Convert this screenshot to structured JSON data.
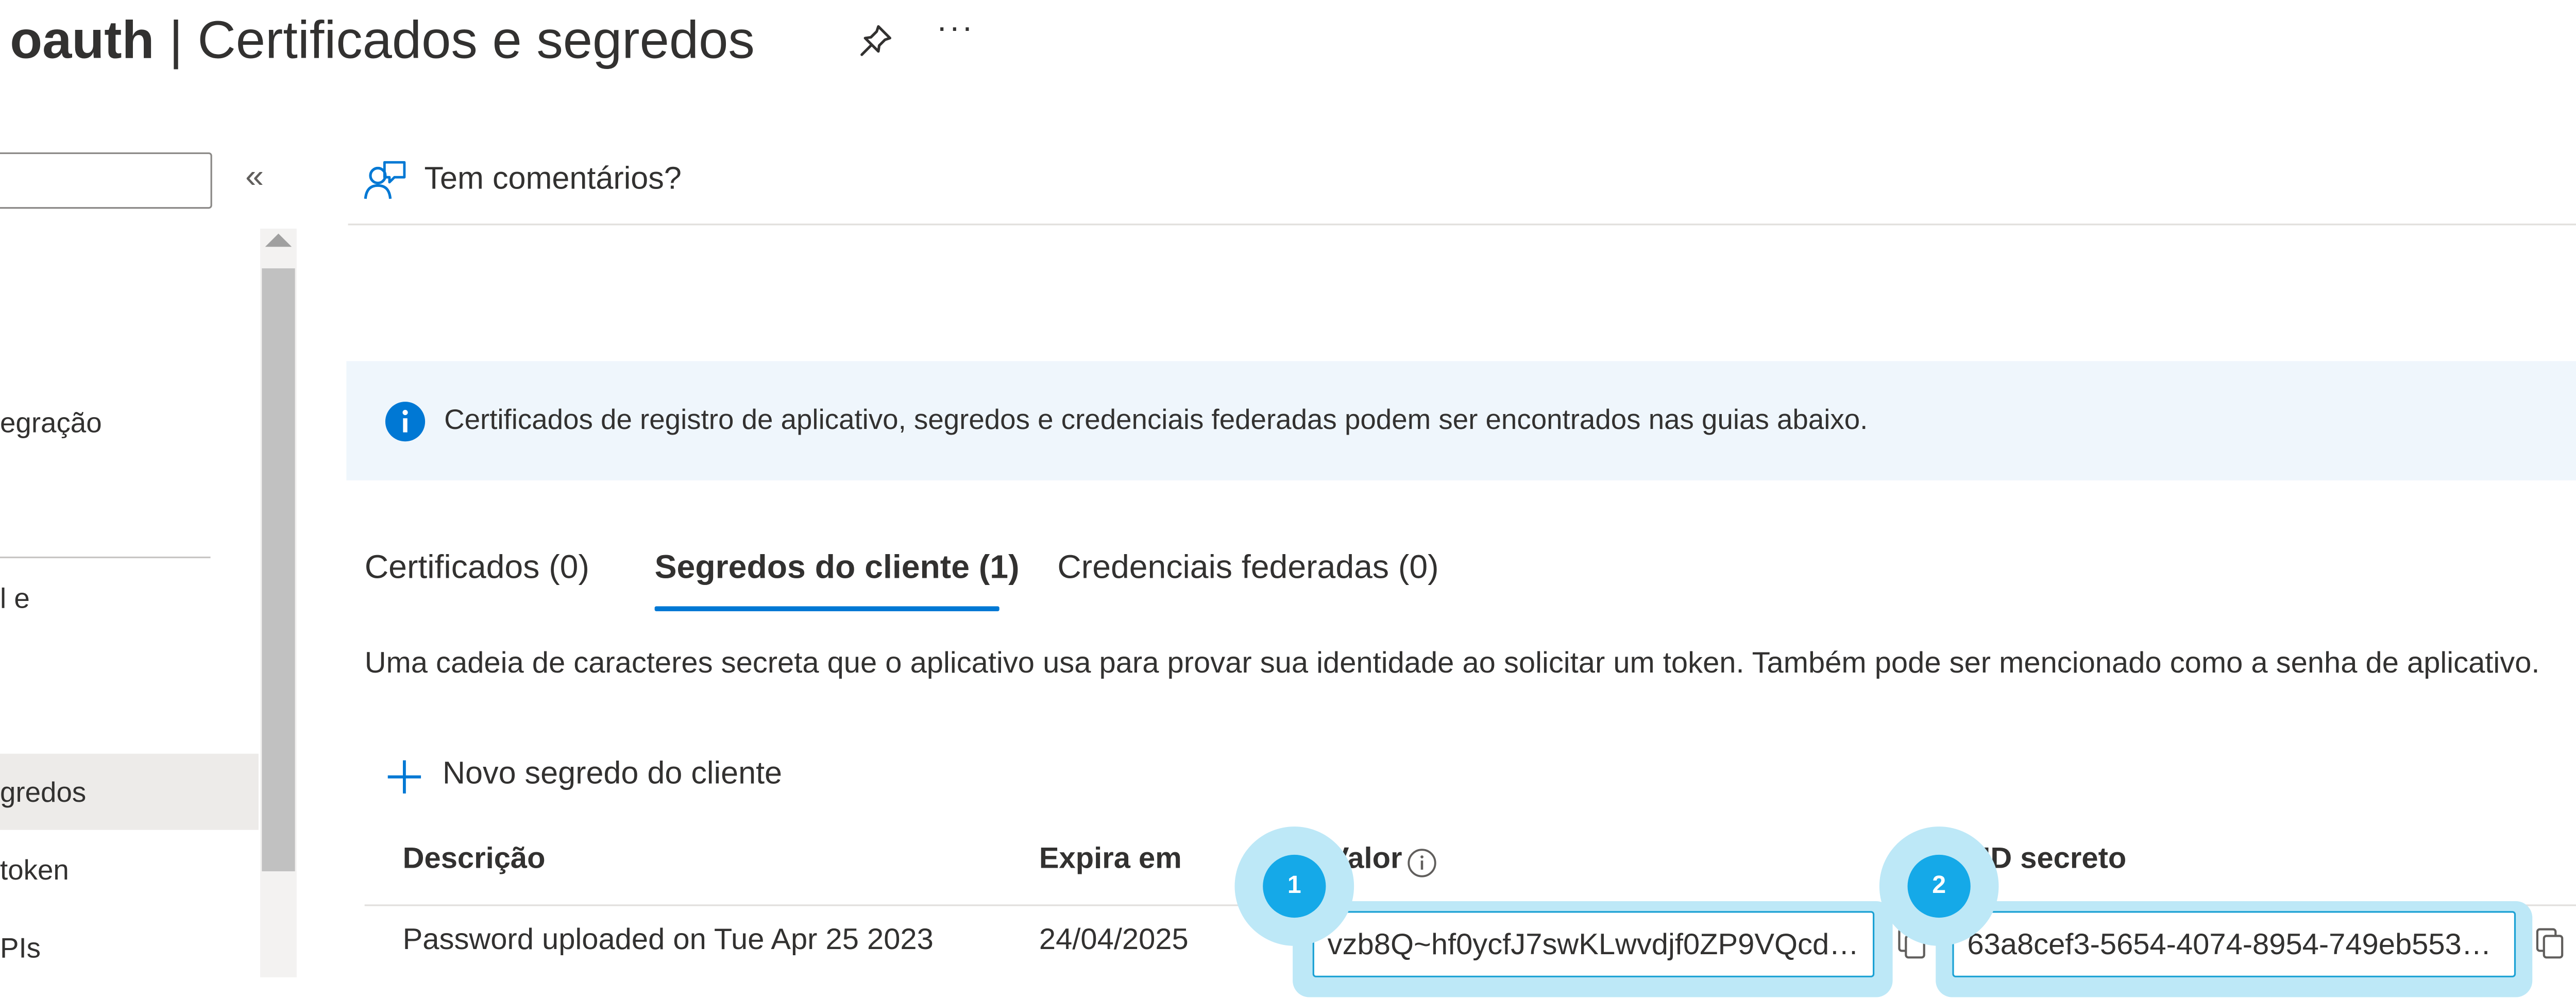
{
  "header": {
    "app_name": "oauth",
    "separator": " | ",
    "page_title": "Certificados e segredos",
    "more_label": "···"
  },
  "sidebar": {
    "collapse_label": "«",
    "items": [
      {
        "label": "egração"
      },
      {
        "label": "l e"
      },
      {
        "label": "gredos",
        "selected": true
      },
      {
        "label": " token"
      },
      {
        "label": "PIs"
      }
    ]
  },
  "command_bar": {
    "feedback_label": "Tem comentários?"
  },
  "banner": {
    "text": "Certificados de registro de aplicativo, segredos e credenciais federadas podem ser encontrados nas guias abaixo.",
    "close_label": "×"
  },
  "tabs": [
    {
      "label": "Certificados (0)",
      "active": false
    },
    {
      "label": "Segredos do cliente (1)",
      "active": true
    },
    {
      "label": "Credenciais federadas (0)",
      "active": false
    }
  ],
  "description": "Uma cadeia de caracteres secreta que o aplicativo usa para provar sua identidade ao solicitar um token. Também pode ser mencionado como a senha de aplicativo.",
  "add_button_label": "Novo segredo do cliente",
  "table": {
    "headers": {
      "description": "Descrição",
      "expires": "Expira em",
      "value": "Valor",
      "secret_id": "ID secreto"
    },
    "rows": [
      {
        "description": "Password uploaded on Tue Apr 25 2023",
        "expires": "24/04/2025",
        "value": "vzb8Q~hf0ycfJ7swKLwvdjf0ZP9VQcdw...",
        "secret_id": "63a8cef3-5654-4074-8954-749eb553e..."
      }
    ]
  },
  "annotations": {
    "badge_1": "1",
    "badge_2": "2"
  },
  "colors": {
    "accent": "#0078d4",
    "banner_bg": "#eff6fc",
    "highlight": "#bde8f7",
    "badge": "#15a9e8"
  }
}
